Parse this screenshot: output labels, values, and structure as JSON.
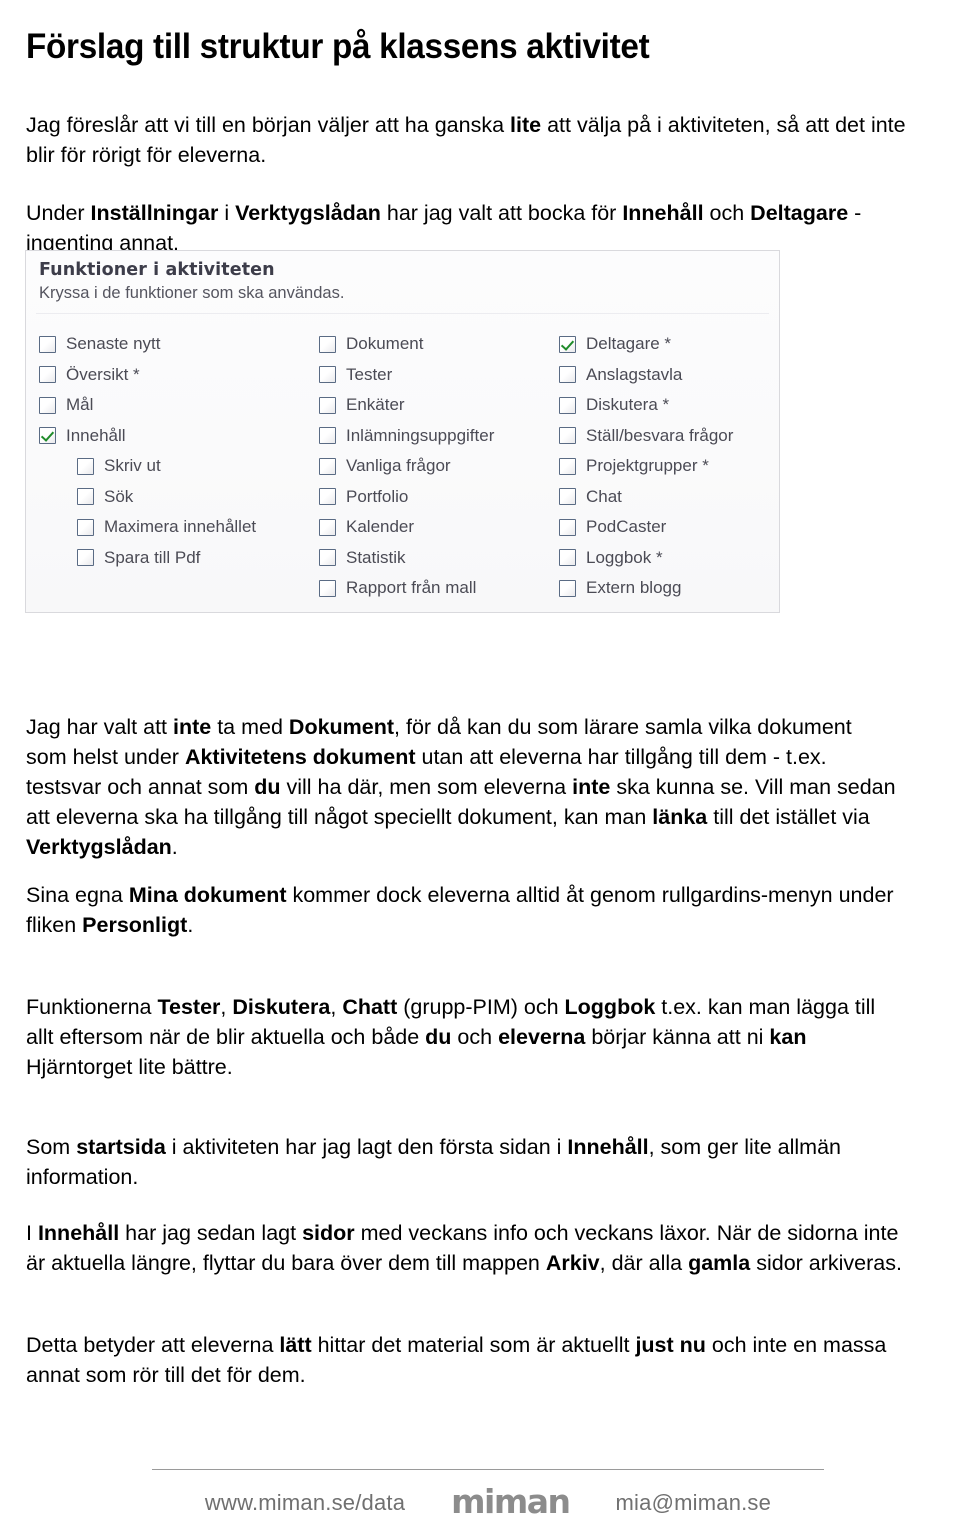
{
  "document": {
    "title": "Förslag till struktur på klassens aktivitet"
  },
  "paragraphs": {
    "intro": {
      "segments": [
        {
          "text": "Jag föreslår att vi till en början väljer att ha ganska ",
          "bold": false
        },
        {
          "text": "lite",
          "bold": true
        },
        {
          "text": " att välja på i aktiviteten, så att det inte blir för rörigt för eleverna.",
          "bold": false
        }
      ]
    },
    "under_installningar": {
      "segments": [
        {
          "text": "Under ",
          "bold": false
        },
        {
          "text": "Inställningar",
          "bold": true
        },
        {
          "text": " i ",
          "bold": false
        },
        {
          "text": "Verktygslådan",
          "bold": true
        },
        {
          "text": " har jag valt att bocka för ",
          "bold": false
        },
        {
          "text": "Innehåll",
          "bold": true
        },
        {
          "text": " och ",
          "bold": false
        },
        {
          "text": "Deltagare",
          "bold": true
        },
        {
          "text": " - ingenting annat.",
          "bold": false
        }
      ]
    },
    "dokument": {
      "segments": [
        {
          "text": "Jag har valt att ",
          "bold": false
        },
        {
          "text": "inte",
          "bold": true
        },
        {
          "text": " ta med ",
          "bold": false
        },
        {
          "text": "Dokument",
          "bold": true
        },
        {
          "text": ", för då kan du som lärare samla vilka dokument som helst under ",
          "bold": false
        },
        {
          "text": "Aktivitetens dokument",
          "bold": true
        },
        {
          "text": " utan att eleverna har tillgång till dem - t.ex. testsvar och annat som ",
          "bold": false
        },
        {
          "text": "du",
          "bold": true
        },
        {
          "text": " vill ha där, men som eleverna ",
          "bold": false
        },
        {
          "text": "inte",
          "bold": true
        },
        {
          "text": " ska kunna se. Vill man sedan att eleverna ska ha tillgång till något speciellt dokument, kan man ",
          "bold": false
        },
        {
          "text": "länka",
          "bold": true
        },
        {
          "text": " till det istället via ",
          "bold": false
        },
        {
          "text": "Verktygslådan",
          "bold": true
        },
        {
          "text": ".",
          "bold": false
        }
      ]
    },
    "mina_dokument": {
      "segments": [
        {
          "text": "Sina egna ",
          "bold": false
        },
        {
          "text": "Mina dokument",
          "bold": true
        },
        {
          "text": " kommer dock eleverna alltid åt genom rullgardins-menyn under fliken ",
          "bold": false
        },
        {
          "text": "Personligt",
          "bold": true
        },
        {
          "text": ".",
          "bold": false
        }
      ]
    },
    "funktionerna": {
      "segments": [
        {
          "text": "Funktionerna ",
          "bold": false
        },
        {
          "text": "Tester",
          "bold": true
        },
        {
          "text": ", ",
          "bold": false
        },
        {
          "text": "Diskutera",
          "bold": true
        },
        {
          "text": ", ",
          "bold": false
        },
        {
          "text": "Chatt",
          "bold": true
        },
        {
          "text": " (grupp-PIM) och ",
          "bold": false
        },
        {
          "text": "Loggbok",
          "bold": true
        },
        {
          "text": " t.ex. kan man lägga till allt eftersom när de blir aktuella och både ",
          "bold": false
        },
        {
          "text": "du",
          "bold": true
        },
        {
          "text": " och ",
          "bold": false
        },
        {
          "text": "eleverna",
          "bold": true
        },
        {
          "text": " börjar känna att ni ",
          "bold": false
        },
        {
          "text": "kan",
          "bold": true
        },
        {
          "text": " Hjärntorget lite bättre.",
          "bold": false
        }
      ]
    },
    "startsida": {
      "segments": [
        {
          "text": "Som ",
          "bold": false
        },
        {
          "text": "startsida",
          "bold": true
        },
        {
          "text": " i aktiviteten har jag lagt den första sidan i ",
          "bold": false
        },
        {
          "text": "Innehåll",
          "bold": true
        },
        {
          "text": ", som ger lite allmän information.",
          "bold": false
        }
      ]
    },
    "innehall_sidor": {
      "segments": [
        {
          "text": "I ",
          "bold": false
        },
        {
          "text": "Innehåll",
          "bold": true
        },
        {
          "text": " har jag sedan lagt ",
          "bold": false
        },
        {
          "text": "sidor",
          "bold": true
        },
        {
          "text": " med veckans info och veckans läxor. När de sidorna inte är aktuella längre, flyttar du bara över dem till mappen ",
          "bold": false
        },
        {
          "text": "Arkiv",
          "bold": true
        },
        {
          "text": ", där alla ",
          "bold": false
        },
        {
          "text": "gamla",
          "bold": true
        },
        {
          "text": " sidor arkiveras.",
          "bold": false
        }
      ]
    },
    "detta_betyder": {
      "segments": [
        {
          "text": "Detta betyder att eleverna ",
          "bold": false
        },
        {
          "text": "lätt",
          "bold": true
        },
        {
          "text": " hittar det material som är aktuellt ",
          "bold": false
        },
        {
          "text": "just nu",
          "bold": true
        },
        {
          "text": " och inte en massa annat som rör till det för dem.",
          "bold": false
        }
      ]
    }
  },
  "panel": {
    "title": "Funktioner i aktiviteten",
    "subtitle": "Kryssa i de funktioner som ska användas.",
    "columns": [
      {
        "items": [
          {
            "label": "Senaste nytt",
            "checked": false,
            "indent": false
          },
          {
            "label": "Översikt *",
            "checked": false,
            "indent": false
          },
          {
            "label": "Mål",
            "checked": false,
            "indent": false
          },
          {
            "label": "Innehåll",
            "checked": true,
            "indent": false
          },
          {
            "label": "Skriv ut",
            "checked": false,
            "indent": true
          },
          {
            "label": "Sök",
            "checked": false,
            "indent": true
          },
          {
            "label": "Maximera innehållet",
            "checked": false,
            "indent": true
          },
          {
            "label": "Spara till Pdf",
            "checked": false,
            "indent": true
          }
        ]
      },
      {
        "items": [
          {
            "label": "Dokument",
            "checked": false,
            "indent": false
          },
          {
            "label": "Tester",
            "checked": false,
            "indent": false
          },
          {
            "label": "Enkäter",
            "checked": false,
            "indent": false
          },
          {
            "label": "Inlämningsuppgifter",
            "checked": false,
            "indent": false
          },
          {
            "label": "Vanliga frågor",
            "checked": false,
            "indent": false
          },
          {
            "label": "Portfolio",
            "checked": false,
            "indent": false
          },
          {
            "label": "Kalender",
            "checked": false,
            "indent": false
          },
          {
            "label": "Statistik",
            "checked": false,
            "indent": false
          },
          {
            "label": "Rapport från mall",
            "checked": false,
            "indent": false
          }
        ]
      },
      {
        "items": [
          {
            "label": "Deltagare *",
            "checked": true,
            "indent": false
          },
          {
            "label": "Anslagstavla",
            "checked": false,
            "indent": false
          },
          {
            "label": "Diskutera *",
            "checked": false,
            "indent": false
          },
          {
            "label": "Ställ/besvara frågor",
            "checked": false,
            "indent": false
          },
          {
            "label": "Projektgrupper *",
            "checked": false,
            "indent": false
          },
          {
            "label": "Chat",
            "checked": false,
            "indent": false
          },
          {
            "label": "PodCaster",
            "checked": false,
            "indent": false
          },
          {
            "label": "Loggbok *",
            "checked": false,
            "indent": false
          },
          {
            "label": "Extern blogg",
            "checked": false,
            "indent": false
          }
        ]
      }
    ]
  },
  "footer": {
    "website": "www.miman.se/data",
    "logo": "miman",
    "email": "mia@miman.se"
  },
  "colors": {
    "check_green": "#1f8b2a",
    "checkbox_border": "#5a6b84",
    "panel_border": "#d9d9dd",
    "panel_title": "#3d3d4a",
    "panel_label": "#4b4b55",
    "footer_gray": "#707070",
    "logo_gray": "#8c8c8c"
  }
}
